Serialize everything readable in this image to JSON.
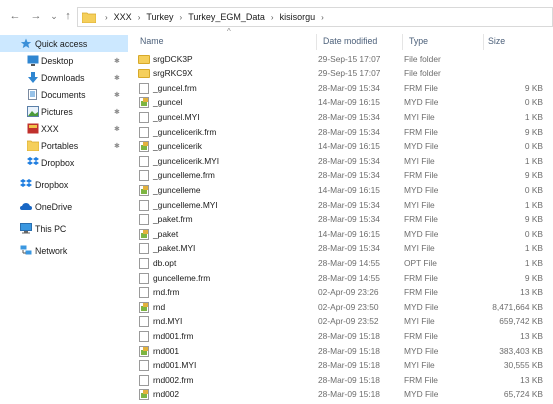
{
  "nav": {
    "back": "←",
    "forward": "→",
    "recent": "⌄",
    "up": "↑"
  },
  "address": {
    "crumbs": [
      "XXX",
      "Turkey",
      "Turkey_EGM_Data",
      "kisisorgu"
    ],
    "separator": "›"
  },
  "sidebar": {
    "items": [
      {
        "label": "Quick access",
        "icon": "star-icon",
        "pinned": false
      },
      {
        "label": "Desktop",
        "icon": "desktop-icon",
        "pinned": true
      },
      {
        "label": "Downloads",
        "icon": "download-icon",
        "pinned": true
      },
      {
        "label": "Documents",
        "icon": "documents-icon",
        "pinned": true
      },
      {
        "label": "Pictures",
        "icon": "pictures-icon",
        "pinned": true
      },
      {
        "label": "XXX",
        "icon": "folder-red-icon",
        "pinned": true
      },
      {
        "label": "Portables",
        "icon": "folder-icon",
        "pinned": true
      },
      {
        "label": "Dropbox",
        "icon": "dropbox-icon",
        "pinned": false
      },
      {
        "label": "Dropbox",
        "icon": "dropbox-icon",
        "pinned": false
      },
      {
        "label": "OneDrive",
        "icon": "onedrive-icon",
        "pinned": false
      },
      {
        "label": "This PC",
        "icon": "pc-icon",
        "pinned": false
      },
      {
        "label": "Network",
        "icon": "network-icon",
        "pinned": false
      }
    ],
    "pin_glyph": "✱"
  },
  "columns": {
    "name": "Name",
    "date": "Date modified",
    "type": "Type",
    "size": "Size",
    "sort_glyph": "^"
  },
  "files": [
    {
      "name": "srgDCK3P",
      "date": "29-Sep-15 17:07",
      "type": "File folder",
      "size": "",
      "icon": "folder"
    },
    {
      "name": "srgRKC9X",
      "date": "29-Sep-15 17:07",
      "type": "File folder",
      "size": "",
      "icon": "folder"
    },
    {
      "name": "_guncel.frm",
      "date": "28-Mar-09 15:34",
      "type": "FRM File",
      "size": "9 KB",
      "icon": "file"
    },
    {
      "name": "_guncel",
      "date": "14-Mar-09 16:15",
      "type": "MYD File",
      "size": "0 KB",
      "icon": "image"
    },
    {
      "name": "_guncel.MYI",
      "date": "28-Mar-09 15:34",
      "type": "MYI File",
      "size": "1 KB",
      "icon": "file"
    },
    {
      "name": "_guncelicerik.frm",
      "date": "28-Mar-09 15:34",
      "type": "FRM File",
      "size": "9 KB",
      "icon": "file"
    },
    {
      "name": "_guncelicerik",
      "date": "14-Mar-09 16:15",
      "type": "MYD File",
      "size": "0 KB",
      "icon": "image"
    },
    {
      "name": "_guncelicerik.MYI",
      "date": "28-Mar-09 15:34",
      "type": "MYI File",
      "size": "1 KB",
      "icon": "file"
    },
    {
      "name": "_guncelleme.frm",
      "date": "28-Mar-09 15:34",
      "type": "FRM File",
      "size": "9 KB",
      "icon": "file"
    },
    {
      "name": "_guncelleme",
      "date": "14-Mar-09 16:15",
      "type": "MYD File",
      "size": "0 KB",
      "icon": "image"
    },
    {
      "name": "_guncelleme.MYI",
      "date": "28-Mar-09 15:34",
      "type": "MYI File",
      "size": "1 KB",
      "icon": "file"
    },
    {
      "name": "_paket.frm",
      "date": "28-Mar-09 15:34",
      "type": "FRM File",
      "size": "9 KB",
      "icon": "file"
    },
    {
      "name": "_paket",
      "date": "14-Mar-09 16:15",
      "type": "MYD File",
      "size": "0 KB",
      "icon": "image"
    },
    {
      "name": "_paket.MYI",
      "date": "28-Mar-09 15:34",
      "type": "MYI File",
      "size": "1 KB",
      "icon": "file"
    },
    {
      "name": "db.opt",
      "date": "28-Mar-09 14:55",
      "type": "OPT File",
      "size": "1 KB",
      "icon": "file"
    },
    {
      "name": "guncelleme.frm",
      "date": "28-Mar-09 14:55",
      "type": "FRM File",
      "size": "9 KB",
      "icon": "file"
    },
    {
      "name": "rnd.frm",
      "date": "02-Apr-09 23:26",
      "type": "FRM File",
      "size": "13 KB",
      "icon": "file"
    },
    {
      "name": "rnd",
      "date": "02-Apr-09 23:50",
      "type": "MYD File",
      "size": "8,471,664 KB",
      "icon": "image"
    },
    {
      "name": "rnd.MYI",
      "date": "02-Apr-09 23:52",
      "type": "MYI File",
      "size": "659,742 KB",
      "icon": "file"
    },
    {
      "name": "rnd001.frm",
      "date": "28-Mar-09 15:18",
      "type": "FRM File",
      "size": "13 KB",
      "icon": "file"
    },
    {
      "name": "rnd001",
      "date": "28-Mar-09 15:18",
      "type": "MYD File",
      "size": "383,403 KB",
      "icon": "image"
    },
    {
      "name": "rnd001.MYI",
      "date": "28-Mar-09 15:18",
      "type": "MYI File",
      "size": "30,555 KB",
      "icon": "file"
    },
    {
      "name": "rnd002.frm",
      "date": "28-Mar-09 15:18",
      "type": "FRM File",
      "size": "13 KB",
      "icon": "file"
    },
    {
      "name": "rnd002",
      "date": "28-Mar-09 15:18",
      "type": "MYD File",
      "size": "65,724 KB",
      "icon": "image"
    }
  ]
}
